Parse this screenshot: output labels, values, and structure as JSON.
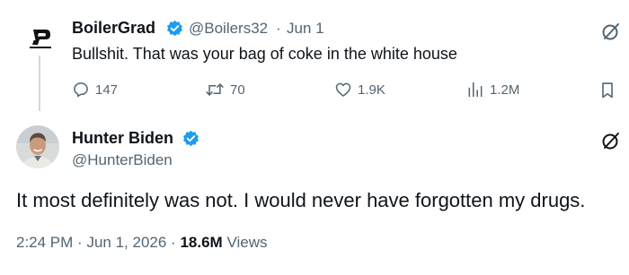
{
  "reply_tweet": {
    "display_name": "BoilerGrad",
    "handle": "@Boilers32",
    "separator": "·",
    "date": "Jun 1",
    "text": "Bullshit. That was your bag of coke in the white house",
    "stats": {
      "replies": "147",
      "retweets": "70",
      "likes": "1.9K",
      "views": "1.2M"
    }
  },
  "main_tweet": {
    "display_name": "Hunter Biden",
    "handle": "@HunterBiden",
    "text": "It most definitely was not. I would never have forgotten my drugs.",
    "time": "2:24 PM",
    "separator": "·",
    "date": "Jun 1, 2026",
    "views_count": "18.6M",
    "views_label": "Views"
  },
  "colors": {
    "text": "#0f1419",
    "secondary": "#536471",
    "verified": "#1d9bf0",
    "thread_line": "#cfd9de"
  }
}
